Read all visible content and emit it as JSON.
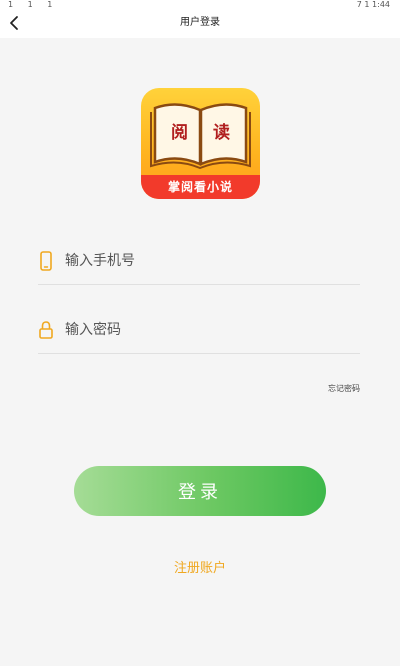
{
  "status_bar": {
    "left": "1 1 1",
    "right": "7 1 1:44"
  },
  "nav": {
    "title": "用户登录",
    "back_icon": "chevron-left-icon"
  },
  "logo": {
    "book_left": "阅",
    "book_right": "读",
    "banner": "掌阅看小说"
  },
  "form": {
    "phone_placeholder": "输入手机号",
    "phone_value": "",
    "phone_icon": "phone-icon",
    "password_placeholder": "输入密码",
    "password_value": "",
    "password_icon": "lock-icon",
    "forgot_label": "忘记密码"
  },
  "login_button": "登录",
  "register_link": "注册账户",
  "colors": {
    "primary_green": "#4cbf55",
    "accent_orange": "#f0a820",
    "logo_red": "#f23a2b",
    "logo_yellow": "#ffc02a"
  }
}
